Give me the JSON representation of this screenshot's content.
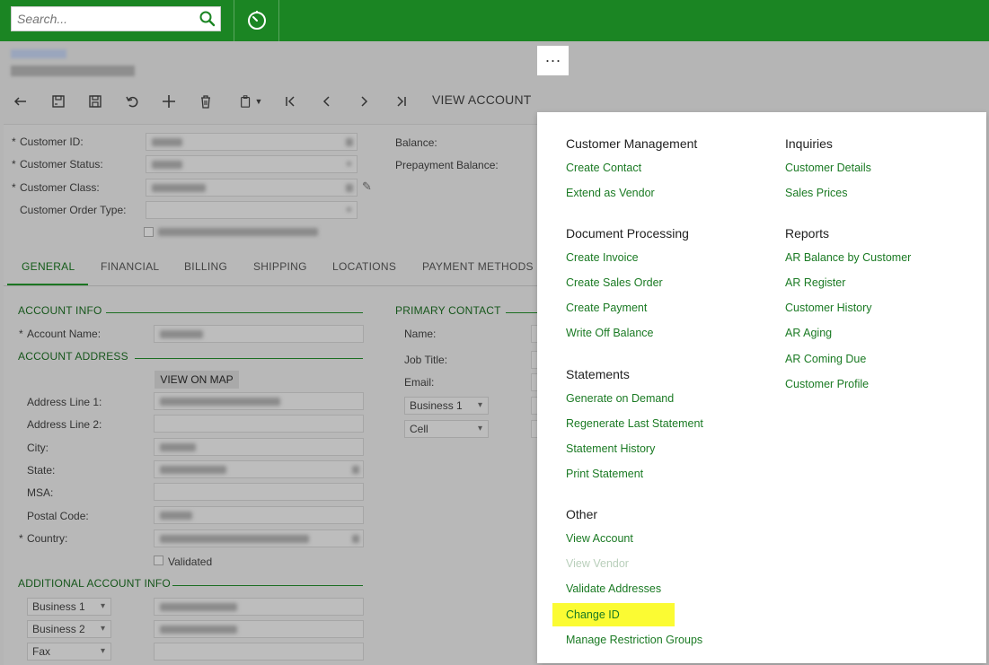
{
  "search": {
    "placeholder": "Search..."
  },
  "toolbar": {
    "view_account_label": "VIEW ACCOUNT",
    "more_label": "···"
  },
  "summary": {
    "customer_id_label": "Customer ID:",
    "customer_status_label": "Customer Status:",
    "customer_class_label": "Customer Class:",
    "customer_order_type_label": "Customer Order Type:",
    "balance_label": "Balance:",
    "prepayment_balance_label": "Prepayment Balance:"
  },
  "tabs": [
    "GENERAL",
    "FINANCIAL",
    "BILLING",
    "SHIPPING",
    "LOCATIONS",
    "PAYMENT METHODS"
  ],
  "general": {
    "account_info": "ACCOUNT INFO",
    "account_name_label": "Account Name:",
    "account_address": "ACCOUNT ADDRESS",
    "view_on_map": "VIEW ON MAP",
    "address_line1_label": "Address Line 1:",
    "address_line2_label": "Address Line 2:",
    "city_label": "City:",
    "state_label": "State:",
    "msa_label": "MSA:",
    "postal_code_label": "Postal Code:",
    "country_label": "Country:",
    "validated_label": "Validated",
    "additional_account_info": "ADDITIONAL ACCOUNT INFO",
    "phone_types": [
      "Business 1",
      "Business 2",
      "Fax"
    ],
    "primary_contact": "PRIMARY CONTACT",
    "name_label": "Name:",
    "job_title_label": "Job Title:",
    "email_label": "Email:",
    "contact_phone_types": [
      "Business 1",
      "Cell"
    ]
  },
  "menu": {
    "customer_management": {
      "title": "Customer Management",
      "items": [
        "Create Contact",
        "Extend as Vendor"
      ]
    },
    "document_processing": {
      "title": "Document Processing",
      "items": [
        "Create Invoice",
        "Create Sales Order",
        "Create Payment",
        "Write Off Balance"
      ]
    },
    "statements": {
      "title": "Statements",
      "items": [
        "Generate on Demand",
        "Regenerate Last Statement",
        "Statement History",
        "Print Statement"
      ]
    },
    "other": {
      "title": "Other",
      "items": [
        "View Account",
        "View Vendor",
        "Validate Addresses",
        "Change ID",
        "Manage Restriction Groups"
      ]
    },
    "inquiries": {
      "title": "Inquiries",
      "items": [
        "Customer Details",
        "Sales Prices"
      ]
    },
    "reports": {
      "title": "Reports",
      "items": [
        "AR Balance by Customer",
        "AR Register",
        "Customer History",
        "AR Aging",
        "AR Coming Due",
        "Customer Profile"
      ]
    },
    "highlight_color": "#fbfb33",
    "link_color": "#1a7a23"
  }
}
